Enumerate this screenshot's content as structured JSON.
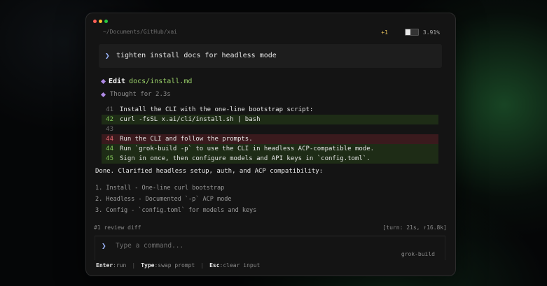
{
  "window": {
    "path": "~/Documents/GitHub/xai",
    "changes": "+1",
    "context_fraction": 0.0391,
    "context_percent": "3.91%"
  },
  "prompt": {
    "text": "tighten install docs for headless mode"
  },
  "edit": {
    "label": "Edit",
    "file": "docs/install.md"
  },
  "thought": "Thought for 2.3s",
  "diff": [
    {
      "line": "41",
      "type": "context",
      "text": "Install the CLI with the one-line bootstrap script:"
    },
    {
      "line": "42",
      "type": "add",
      "text": "curl -fsSL x.ai/cli/install.sh | bash"
    },
    {
      "line": "43",
      "type": "context",
      "text": ""
    },
    {
      "line": "44",
      "type": "del",
      "text": "Run the CLI and follow the prompts."
    },
    {
      "line": "44",
      "type": "add",
      "text": "Run `grok-build -p` to use the CLI in headless ACP-compatible mode."
    },
    {
      "line": "45",
      "type": "add",
      "text": "Sign in once, then configure models and API keys in `config.toml`."
    }
  ],
  "done": "Done. Clarified headless setup, auth, and ACP compatibility:",
  "summary": [
    "1. Install - One-line curl bootstrap",
    "2. Headless - Documented `-p` ACP mode",
    "3. Config - `config.toml` for models and keys"
  ],
  "footer": {
    "review": "#1 review diff",
    "turn": "[turn: 21s, ↑16.8k]"
  },
  "input": {
    "placeholder": "Type a command...",
    "brand": "grok-build"
  },
  "hints": [
    {
      "key": "Enter",
      "action": ":run"
    },
    {
      "key": "Type",
      "action": ":swap prompt"
    },
    {
      "key": "Esc",
      "action": ":clear input"
    }
  ],
  "colors": {
    "accent_chevron": "#9fb8ff",
    "diff_add_bg": "#1e2c16",
    "diff_del_bg": "#3a1a1d",
    "edit_file": "#9bd26a",
    "diamond": "#b08ae6",
    "changes": "#e6c15c"
  },
  "icons": {
    "prompt": "chevron-right-icon",
    "edit": "diamond-icon",
    "thought": "diamond-icon"
  }
}
